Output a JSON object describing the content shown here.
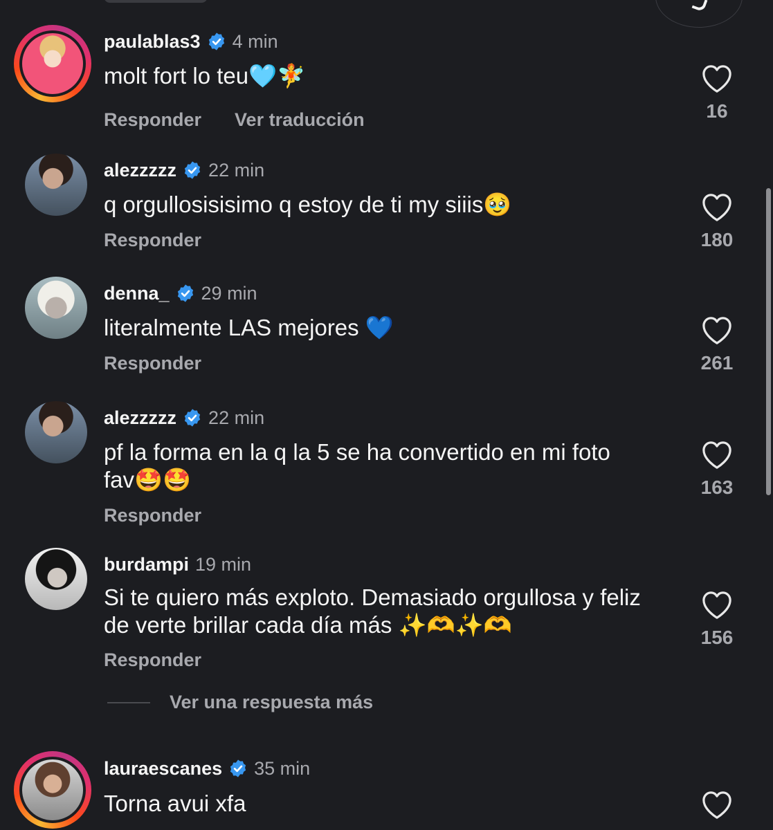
{
  "comments": [
    {
      "username": "paulablas3",
      "verified": true,
      "time": "4 min",
      "text": "molt fort lo teu🩵🧚",
      "actions": [
        "Responder",
        "Ver traducción"
      ],
      "likes": "16"
    },
    {
      "username": "alezzzzz",
      "verified": true,
      "time": "22 min",
      "text": "q orgullosisisimo q estoy de ti my siiis🥹",
      "actions": [
        "Responder"
      ],
      "likes": "180"
    },
    {
      "username": "denna_",
      "verified": true,
      "time": "29 min",
      "text": "literalmente LAS mejores 💙",
      "actions": [
        "Responder"
      ],
      "likes": "261"
    },
    {
      "username": "alezzzzz",
      "verified": true,
      "time": "22 min",
      "text": "pf la forma en la q la 5 se ha convertido en mi foto fav🤩🤩",
      "actions": [
        "Responder"
      ],
      "likes": "163"
    },
    {
      "username": "burdampi",
      "verified": false,
      "time": "19 min",
      "text": "Si te quiero más exploto. Demasiado orgullosa y feliz de verte brillar cada día más ✨🫶✨🫶",
      "actions": [
        "Responder"
      ],
      "likes": "156"
    },
    {
      "username": "lauraescanes",
      "verified": true,
      "time": "35 min",
      "text": "Torna avui xfa",
      "actions": [],
      "likes": ""
    }
  ],
  "more_replies_label": "Ver una respuesta más",
  "colors": {
    "background": "#1c1d21",
    "text": "#f5f5f5",
    "muted": "#a8a9ae",
    "verified": "#3897f0"
  }
}
